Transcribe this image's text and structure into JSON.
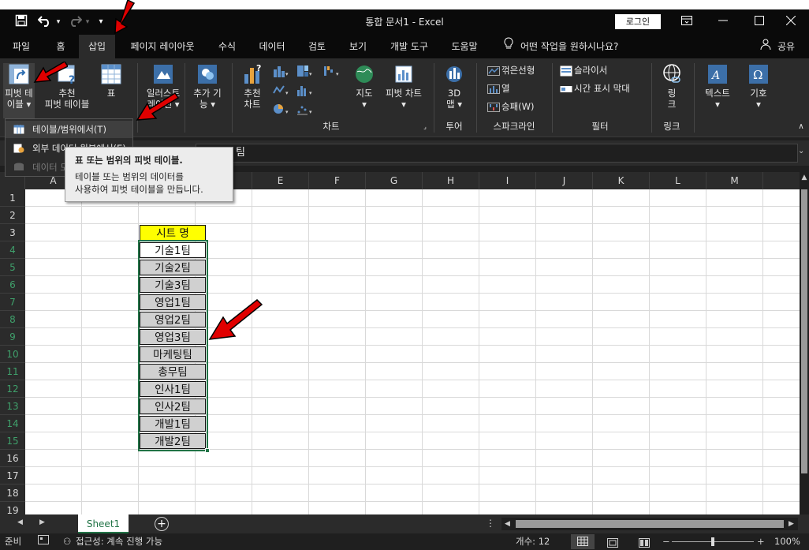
{
  "app": {
    "title": "통합 문서1  -  Excel",
    "login_label": "로그인"
  },
  "quick_access": {
    "save_icon": "save-icon",
    "undo_icon": "undo-icon",
    "redo_icon": "redo-icon",
    "customize_icon": "customize-icon"
  },
  "window_controls": {
    "restore_ribbon_icon": "ribbon-display-icon",
    "minimize_icon": "minimize-icon",
    "maximize_icon": "maximize-icon",
    "close_icon": "close-icon"
  },
  "menu_tabs": [
    {
      "label": "파일"
    },
    {
      "label": "홈"
    },
    {
      "label": "삽입",
      "active": true
    },
    {
      "label": "페이지 레이아웃"
    },
    {
      "label": "수식"
    },
    {
      "label": "데이터"
    },
    {
      "label": "검토"
    },
    {
      "label": "보기"
    },
    {
      "label": "개발 도구"
    },
    {
      "label": "도움말"
    }
  ],
  "tell_me": "어떤 작업을 원하시나요?",
  "share_label": "공유",
  "ribbon": {
    "pivot_table": {
      "line1": "피벗 테",
      "line2": "이블 ▾"
    },
    "recommended_pivot": {
      "line1": "추천",
      "line2": "피벗 테이블"
    },
    "table": {
      "label": "표"
    },
    "illustrations": {
      "line1": "일러스트",
      "line2": "레이션 ▾"
    },
    "addins": {
      "line1": "추가 기",
      "line2": "능 ▾"
    },
    "recommended_charts": {
      "line1": "추천",
      "line2": "차트"
    },
    "maps": {
      "line1": "지도",
      "line2": "▾"
    },
    "pivot_chart": {
      "line1": "피벗 차트",
      "line2": "▾"
    },
    "charts_group": "차트",
    "map3d": {
      "line1": "3D",
      "line2": "맵 ▾"
    },
    "tours_group": "투어",
    "sparklines": [
      "꺾은선형",
      "열",
      "승패(W)"
    ],
    "sparklines_group": "스파크라인",
    "filters": [
      "슬라이서",
      "시간 표시 막대"
    ],
    "filters_group": "필터",
    "link": {
      "line1": "링",
      "line2": "크"
    },
    "links_group": "링크",
    "text": {
      "label": "텍스트",
      "line2": "▾"
    },
    "symbols": {
      "label": "기호",
      "line2": "▾"
    }
  },
  "dropdown": {
    "items": [
      {
        "label": "테이블/범위에서(T)",
        "state": "hover"
      },
      {
        "label": "외부 데이터 원본에서(E)",
        "state": "normal"
      },
      {
        "label": "데이터 모델에서(D)",
        "state": "disabled"
      }
    ]
  },
  "tooltip": {
    "title": "표 또는 범위의 피벗 테이블.",
    "body_line1": "테이블 또는 범위의 데이터를",
    "body_line2": "사용하여 피벗 테이블을 만듭니다."
  },
  "formula_bar": {
    "value": "팀"
  },
  "columns": [
    "A",
    "B",
    "C",
    "D",
    "E",
    "F",
    "G",
    "H",
    "I",
    "J",
    "K",
    "L",
    "M"
  ],
  "rows": [
    "1",
    "2",
    "3",
    "4",
    "5",
    "6",
    "7",
    "8",
    "9",
    "10",
    "11",
    "12",
    "13",
    "14",
    "15",
    "16",
    "17",
    "18",
    "19"
  ],
  "sheet_cells": {
    "header": "시트 명",
    "values": [
      "기술1팀",
      "기술2팀",
      "기술3팀",
      "영업1팀",
      "영업2팀",
      "영업3팀",
      "마케팅팀",
      "총무팀",
      "인사1팀",
      "인사2팀",
      "개발1팀",
      "개발2팀"
    ]
  },
  "sheet_tabs": [
    {
      "label": "Sheet1"
    }
  ],
  "status": {
    "ready": "준비",
    "accessibility": "접근성: 계속 진행 가능",
    "count": "개수: 12",
    "zoom": "100%"
  },
  "colors": {
    "accent": "#217346",
    "header_fill": "#ffff00",
    "cell_fill": "#d0d0d0",
    "annotation_arrow": "#e00000"
  }
}
